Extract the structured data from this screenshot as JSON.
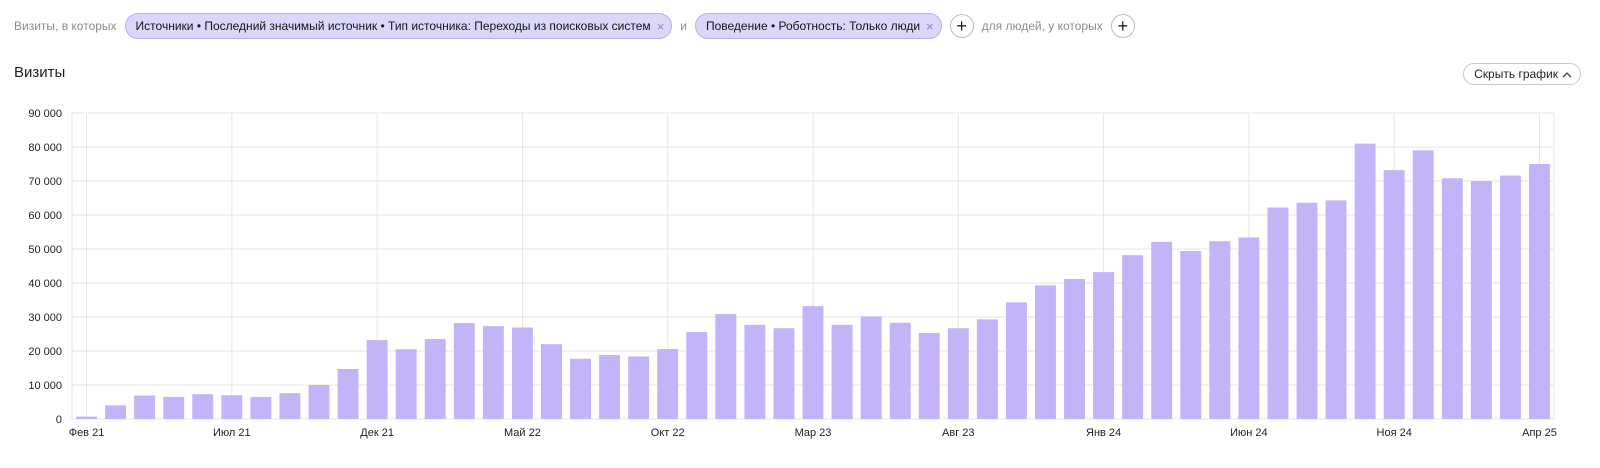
{
  "filters": {
    "prefix": "Визиты, в которых",
    "chip1": "Источники • Последний значимый источник • Тип источника: Переходы из поисковых систем",
    "connector": "и",
    "chip2": "Поведение • Роботность: Только люди",
    "people_label": "для людей, у которых",
    "close_glyph": "×",
    "plus_glyph": "+"
  },
  "title": "Визиты",
  "hide_chart_button": "Скрыть график",
  "colors": {
    "bar": "#c3b3f7",
    "grid": "#e6e6e6",
    "chip_bg": "#dad7fb"
  },
  "chart_data": {
    "type": "bar",
    "ylabel": "",
    "xlabel": "",
    "ylim": [
      0,
      90000
    ],
    "y_ticks": [
      0,
      10000,
      20000,
      30000,
      40000,
      50000,
      60000,
      70000,
      80000,
      90000
    ],
    "y_tick_labels": [
      "0",
      "10 000",
      "20 000",
      "30 000",
      "40 000",
      "50 000",
      "60 000",
      "70 000",
      "80 000",
      "90 000"
    ],
    "x_tick_labels": [
      {
        "label": "Фев 21",
        "index": 0
      },
      {
        "label": "Июл 21",
        "index": 5
      },
      {
        "label": "Дек 21",
        "index": 10
      },
      {
        "label": "Май 22",
        "index": 15
      },
      {
        "label": "Окт 22",
        "index": 20
      },
      {
        "label": "Мар 23",
        "index": 25
      },
      {
        "label": "Авг 23",
        "index": 30
      },
      {
        "label": "Янв 24",
        "index": 35
      },
      {
        "label": "Июн 24",
        "index": 40
      },
      {
        "label": "Ноя 24",
        "index": 45
      },
      {
        "label": "Апр 25",
        "index": 50
      }
    ],
    "categories": [
      "2021-02",
      "2021-03",
      "2021-04",
      "2021-05",
      "2021-06",
      "2021-07",
      "2021-08",
      "2021-09",
      "2021-10",
      "2021-11",
      "2021-12",
      "2022-01",
      "2022-02",
      "2022-03",
      "2022-04",
      "2022-05",
      "2022-06",
      "2022-07",
      "2022-08",
      "2022-09",
      "2022-10",
      "2022-11",
      "2022-12",
      "2023-01",
      "2023-02",
      "2023-03",
      "2023-04",
      "2023-05",
      "2023-06",
      "2023-07",
      "2023-08",
      "2023-09",
      "2023-10",
      "2023-11",
      "2023-12",
      "2024-01",
      "2024-02",
      "2024-03",
      "2024-04",
      "2024-05",
      "2024-06",
      "2024-07",
      "2024-08",
      "2024-09",
      "2024-10",
      "2024-11",
      "2024-12",
      "2025-01",
      "2025-02",
      "2025-03",
      "2025-04"
    ],
    "values": [
      700,
      4000,
      6900,
      6500,
      7300,
      7000,
      6500,
      7600,
      10000,
      14700,
      23200,
      20500,
      23500,
      28200,
      27300,
      26900,
      22000,
      17700,
      18800,
      18400,
      20600,
      25600,
      30900,
      27700,
      26700,
      33200,
      27700,
      30200,
      28300,
      25300,
      26700,
      29300,
      34300,
      39300,
      41200,
      43200,
      48200,
      52100,
      49400,
      52300,
      53400,
      62200,
      63600,
      64300,
      81000,
      73200,
      79000,
      70800,
      70000,
      71600,
      75000
    ]
  }
}
